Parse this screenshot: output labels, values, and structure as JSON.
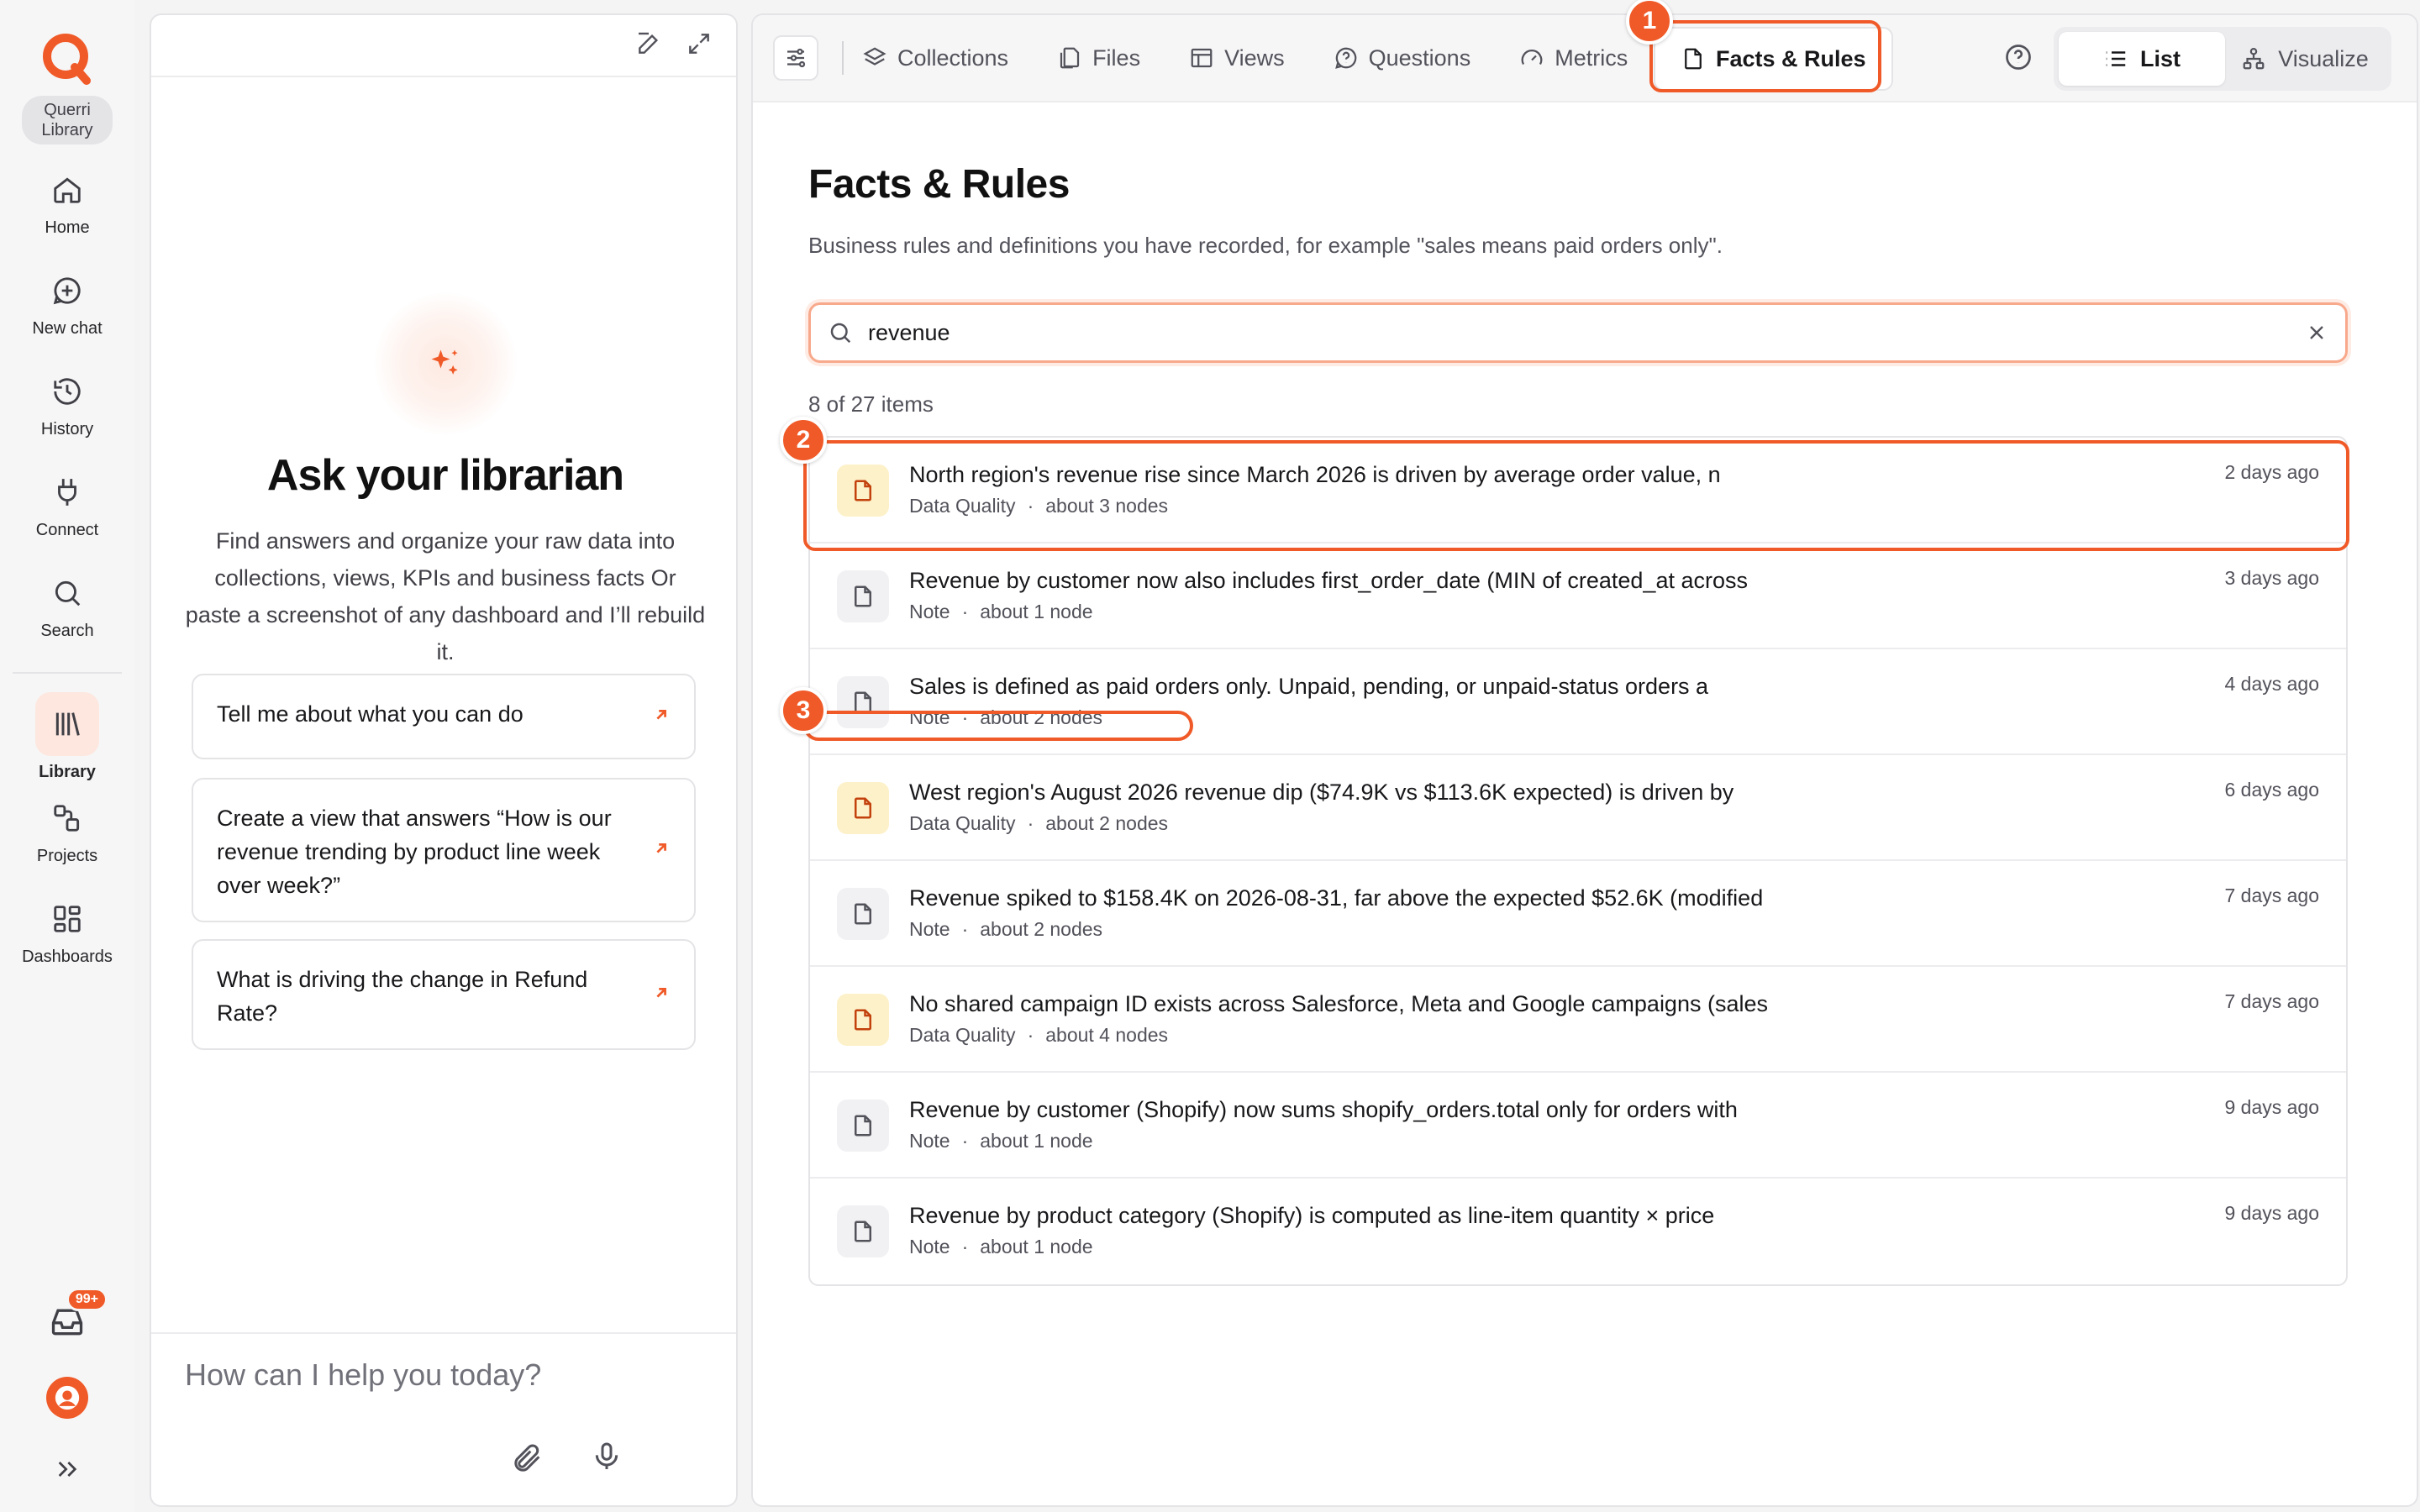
{
  "brand": {
    "name_line1": "Querri",
    "name_line2": "Library",
    "accent": "#f05a28"
  },
  "rail": {
    "items": [
      {
        "label": "Home",
        "icon": "home-icon"
      },
      {
        "label": "New chat",
        "icon": "new-chat-icon"
      },
      {
        "label": "History",
        "icon": "history-icon"
      },
      {
        "label": "Connect",
        "icon": "plug-icon"
      },
      {
        "label": "Search",
        "icon": "search-icon"
      }
    ],
    "items2": [
      {
        "label": "Library",
        "icon": "library-icon",
        "active": true
      },
      {
        "label": "Projects",
        "icon": "projects-icon"
      },
      {
        "label": "Dashboards",
        "icon": "dashboards-icon"
      }
    ],
    "inbox_badge": "99+"
  },
  "chat": {
    "title": "Ask your librarian",
    "description": "Find answers and organize your raw data into collections, views, KPIs and business facts Or paste a screenshot of any dashboard and I’ll rebuild it.",
    "suggestions": [
      "Tell me about what you can do",
      "Create a view that answers “How is our revenue trending by product line week over week?”",
      "What is driving the change in Refund Rate?"
    ],
    "input_placeholder": "How can I help you today?"
  },
  "toolbar": {
    "tabs": [
      "Collections",
      "Files",
      "Views",
      "Questions",
      "Metrics",
      "Facts & Rules"
    ],
    "active_tab": "Facts & Rules",
    "view_toggle": {
      "list": "List",
      "visualize": "Visualize",
      "selected": "List"
    }
  },
  "page": {
    "title": "Facts & Rules",
    "subtitle": "Business rules and definitions you have recorded, for example \"sales means paid orders only\".",
    "search_value": "revenue",
    "count_text": "8 of 27 items"
  },
  "items": [
    {
      "title": "North region's revenue rise since March 2026 is driven by average order value, n",
      "type": "Data Quality",
      "nodes": "about 3 nodes",
      "time": "2 days ago"
    },
    {
      "title": "Revenue by customer now also includes first_order_date (MIN of created_at across",
      "type": "Note",
      "nodes": "about 1 node",
      "time": "3 days ago"
    },
    {
      "title": "Sales is defined as paid orders only. Unpaid, pending, or unpaid-status orders a",
      "type": "Note",
      "nodes": "about 2 nodes",
      "time": "4 days ago"
    },
    {
      "title": "West region's August 2026 revenue dip ($74.9K vs $113.6K expected) is driven by",
      "type": "Data Quality",
      "nodes": "about 2 nodes",
      "time": "6 days ago"
    },
    {
      "title": "Revenue spiked to $158.4K on 2026-08-31, far above the expected $52.6K (modified",
      "type": "Note",
      "nodes": "about 2 nodes",
      "time": "7 days ago"
    },
    {
      "title": "No shared campaign ID exists across Salesforce, Meta and Google campaigns (sales",
      "type": "Data Quality",
      "nodes": "about 4 nodes",
      "time": "7 days ago"
    },
    {
      "title": "Revenue by customer (Shopify) now sums shopify_orders.total only for orders with",
      "type": "Note",
      "nodes": "about 1 node",
      "time": "9 days ago"
    },
    {
      "title": "Revenue by product category (Shopify) is computed as line-item quantity × price",
      "type": "Note",
      "nodes": "about 1 node",
      "time": "9 days ago"
    }
  ],
  "annotations": {
    "m1": "1",
    "m2": "2",
    "m3": "3"
  }
}
